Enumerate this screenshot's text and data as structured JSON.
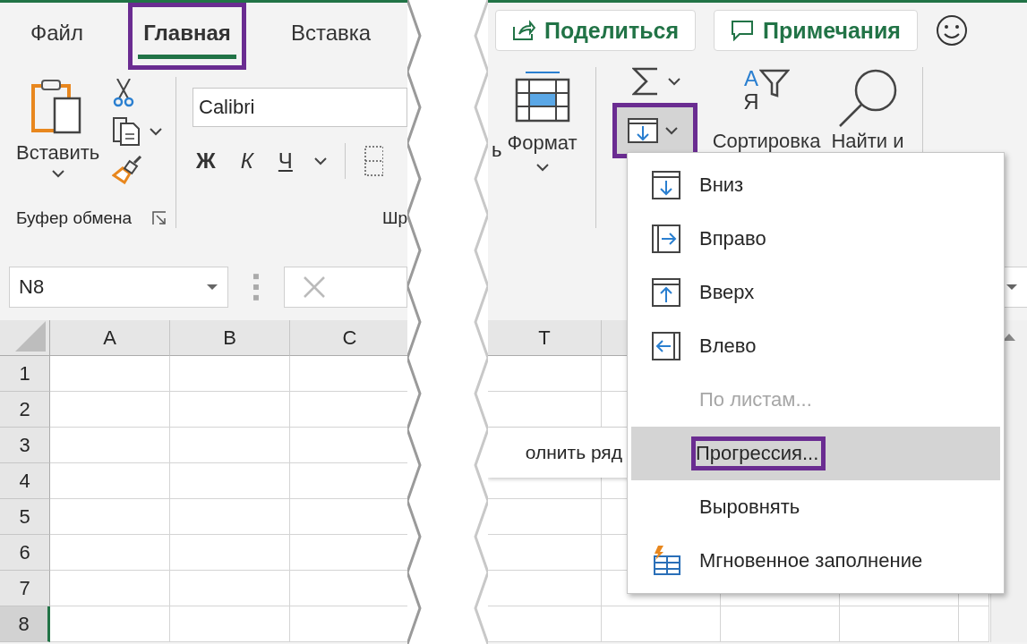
{
  "left": {
    "tabs": [
      {
        "label": "Файл",
        "selected": false,
        "annotated": false
      },
      {
        "label": "Главная",
        "selected": true,
        "annotated": true
      },
      {
        "label": "Вставка",
        "selected": false,
        "annotated": false
      }
    ],
    "clipboard": {
      "paste_label": "Вставить",
      "group_label": "Буфер обмена"
    },
    "font": {
      "name": "Calibri",
      "buttons": [
        {
          "label": "Ж",
          "kind": "bold"
        },
        {
          "label": "К",
          "kind": "italic"
        },
        {
          "label": "Ч",
          "kind": "underline"
        }
      ],
      "group_label": "Шр"
    },
    "name_box": "N8",
    "columns": [
      "A",
      "B",
      "C"
    ],
    "rows": [
      {
        "label": "1",
        "selected": false
      },
      {
        "label": "2",
        "selected": false
      },
      {
        "label": "3",
        "selected": false
      },
      {
        "label": "4",
        "selected": false
      },
      {
        "label": "5",
        "selected": false
      },
      {
        "label": "6",
        "selected": false
      },
      {
        "label": "7",
        "selected": false
      },
      {
        "label": "8",
        "selected": true
      }
    ]
  },
  "right": {
    "share_button": "Поделиться",
    "comments_button": "Примечания",
    "cut_text": "ь",
    "format_label": "Формат",
    "fill_button": {
      "annotated": true
    },
    "sort_letters": [
      "А",
      "Я"
    ],
    "sort_label": "Сортировка",
    "find_label": "Найти и",
    "columns": [
      "T"
    ],
    "side_item": "олнить ряд",
    "menu": [
      {
        "label": "Вниз",
        "kind": "down",
        "disabled": false,
        "selected": false,
        "annotated": false
      },
      {
        "label": "Вправо",
        "kind": "right",
        "disabled": false,
        "selected": false,
        "annotated": false
      },
      {
        "label": "Вверх",
        "kind": "up",
        "disabled": false,
        "selected": false,
        "annotated": false
      },
      {
        "label": "Влево",
        "kind": "left",
        "disabled": false,
        "selected": false,
        "annotated": false
      },
      {
        "label": "По листам...",
        "kind": "plain",
        "disabled": true,
        "selected": false,
        "annotated": false
      },
      {
        "label": "Прогрессия...",
        "kind": "plain",
        "disabled": false,
        "selected": true,
        "annotated": true
      },
      {
        "label": "Выровнять",
        "kind": "plain",
        "disabled": false,
        "selected": false,
        "annotated": false
      },
      {
        "label": "Мгновенное заполнение",
        "kind": "flash",
        "disabled": false,
        "selected": false,
        "annotated": false
      }
    ]
  }
}
